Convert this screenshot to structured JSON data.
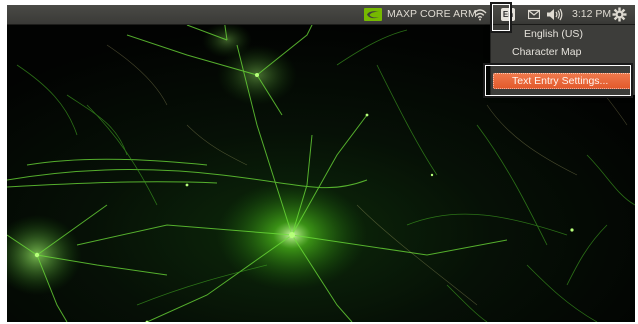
{
  "panel": {
    "host_label": "MAXP CORE ARM",
    "keyboard_indicator": "En",
    "clock": "3:12 PM",
    "icons": [
      "nvidia-logo",
      "wifi-icon",
      "mail-icon",
      "sound-icon",
      "settings-gear-icon"
    ]
  },
  "menu": {
    "items": [
      {
        "label": "English (US)"
      },
      {
        "label": "Character Map"
      },
      {
        "label": "Text Entry Settings..."
      }
    ]
  },
  "colors": {
    "panel_bg": "#3f3f3c",
    "menu_bg": "#3d3d3a",
    "menu_highlight": "#e8633a",
    "wallpaper_glow": "#7cff3a"
  }
}
